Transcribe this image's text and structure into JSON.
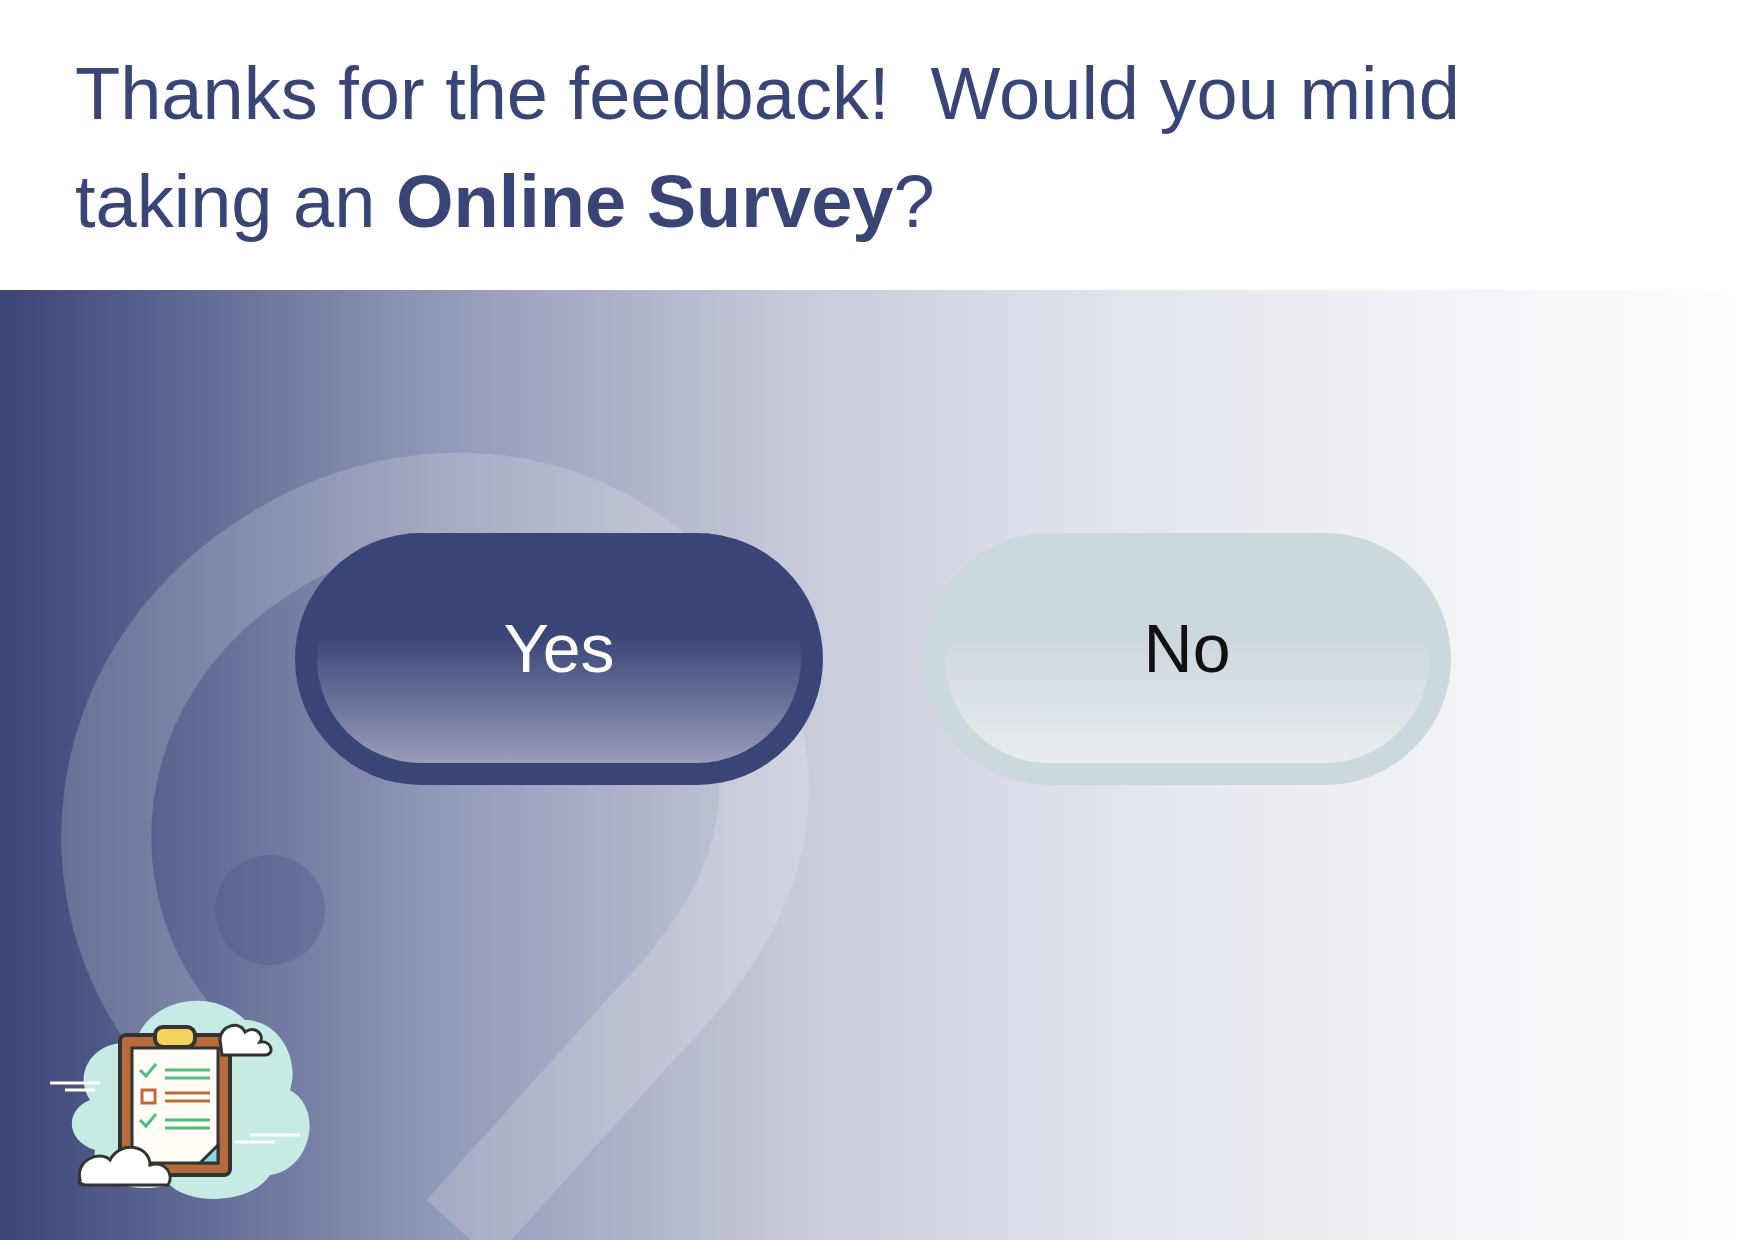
{
  "prompt": "Thanks for the feedback!  Would you mind taking an **Online Survey**?",
  "buttons": [
    {
      "label": "Yes",
      "kind": "primary"
    },
    {
      "label": "No",
      "kind": "secondary"
    }
  ]
}
